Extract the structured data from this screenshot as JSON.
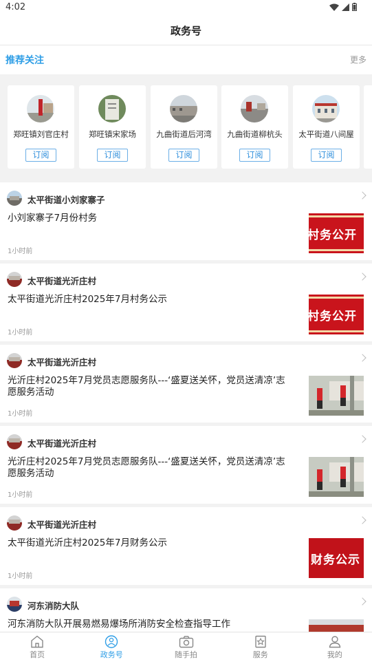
{
  "status": {
    "time": "4:02"
  },
  "header": {
    "title": "政务号"
  },
  "recommend": {
    "title": "推荐关注",
    "more": "更多"
  },
  "cards": [
    {
      "name": "郑旺镇刘官庄村",
      "button": "订阅"
    },
    {
      "name": "郑旺镇宋家场",
      "button": "订阅"
    },
    {
      "name": "九曲街道后河湾",
      "button": "订阅"
    },
    {
      "name": "九曲街道柳杭头",
      "button": "订阅"
    },
    {
      "name": "太平街道八间屋",
      "button": "订阅"
    }
  ],
  "posts": [
    {
      "source": "太平街道小刘家寨子",
      "title": "小刘家寨子7月份村务",
      "time": "1小时前",
      "thumb_text": "村务公开"
    },
    {
      "source": "太平街道光沂庄村",
      "title": "太平街道光沂庄村2025年7月村务公示",
      "time": "1小时前",
      "thumb_text": "村务公开"
    },
    {
      "source": "太平街道光沂庄村",
      "title": "光沂庄村2025年7月党员志愿服务队---‘盛夏送关怀，党员送清凉’志愿服务活动",
      "time": "1小时前"
    },
    {
      "source": "太平街道光沂庄村",
      "title": "光沂庄村2025年7月党员志愿服务队---‘盛夏送关怀，党员送清凉’志愿服务活动",
      "time": "1小时前"
    },
    {
      "source": "太平街道光沂庄村",
      "title": "太平街道光沂庄村2025年7月财务公示",
      "time": "1小时前",
      "thumb_text": "财务公示"
    },
    {
      "source": "河东消防大队",
      "title": "河东消防大队开展易燃易爆场所消防安全检查指导工作",
      "time": ""
    }
  ],
  "tabs": [
    {
      "label": "首页",
      "icon": "home-icon"
    },
    {
      "label": "政务号",
      "icon": "gov-account-icon",
      "active": true
    },
    {
      "label": "随手拍",
      "icon": "camera-icon"
    },
    {
      "label": "服务",
      "icon": "service-icon"
    },
    {
      "label": "我的",
      "icon": "profile-icon"
    }
  ],
  "colors": {
    "accent": "#2f9ee6",
    "thumb_red": "#c9141c"
  }
}
